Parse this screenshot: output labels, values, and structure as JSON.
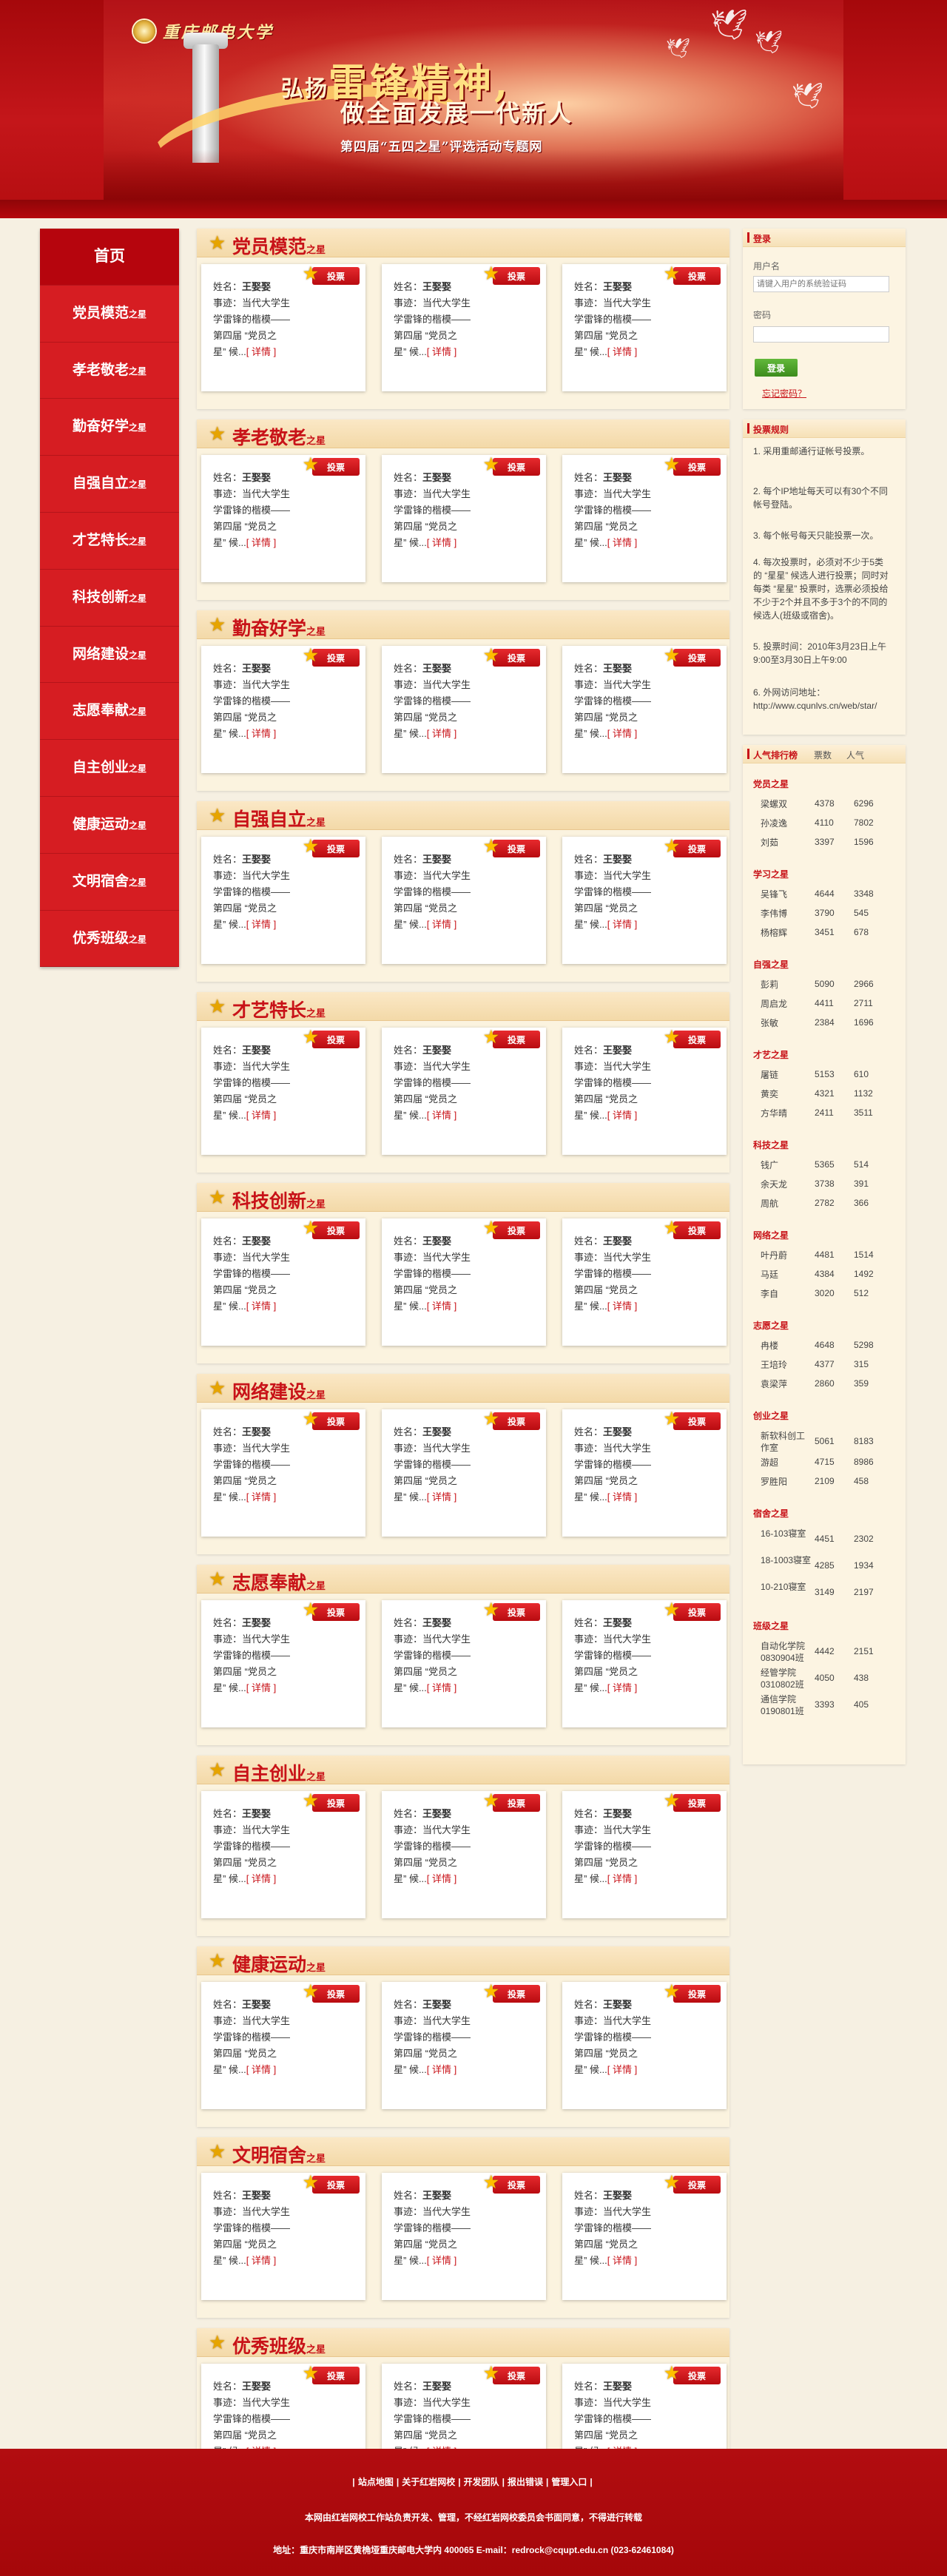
{
  "header": {
    "school_name": "重庆邮电大学",
    "slogan_small": "弘扬",
    "slogan_big": "雷锋精神,",
    "slogan_line2": "做全面发展一代新人",
    "subtitle": "第四届“五四之星”评选活动专题网"
  },
  "nav": {
    "home": "首页",
    "items": [
      {
        "main": "党员模范",
        "suffix": "之星"
      },
      {
        "main": "孝老敬老",
        "suffix": "之星"
      },
      {
        "main": "勤奋好学",
        "suffix": "之星"
      },
      {
        "main": "自强自立",
        "suffix": "之星"
      },
      {
        "main": "才艺特长",
        "suffix": "之星"
      },
      {
        "main": "科技创新",
        "suffix": "之星"
      },
      {
        "main": "网络建设",
        "suffix": "之星"
      },
      {
        "main": "志愿奉献",
        "suffix": "之星"
      },
      {
        "main": "自主创业",
        "suffix": "之星"
      },
      {
        "main": "健康运动",
        "suffix": "之星"
      },
      {
        "main": "文明宿舍",
        "suffix": "之星"
      },
      {
        "main": "优秀班级",
        "suffix": "之星"
      }
    ]
  },
  "card": {
    "vote_label": "投票",
    "name_label": "姓名：",
    "name_value": "王娶娶",
    "line2": "事迹：当代大学生",
    "line3": "学雷锋的楷模——",
    "line4": "第四届 “党员之",
    "line5_pre": "星” 候...",
    "detail_text": "[ 详情 ]"
  },
  "sections": [
    {
      "title": "党员模范",
      "suffix": "之星"
    },
    {
      "title": "孝老敬老",
      "suffix": "之星"
    },
    {
      "title": "勤奋好学",
      "suffix": "之星"
    },
    {
      "title": "自强自立",
      "suffix": "之星"
    },
    {
      "title": "才艺特长",
      "suffix": "之星"
    },
    {
      "title": "科技创新",
      "suffix": "之星"
    },
    {
      "title": "网络建设",
      "suffix": "之星"
    },
    {
      "title": "志愿奉献",
      "suffix": "之星"
    },
    {
      "title": "自主创业",
      "suffix": "之星"
    },
    {
      "title": "健康运动",
      "suffix": "之星"
    },
    {
      "title": "文明宿舍",
      "suffix": "之星"
    },
    {
      "title": "优秀班级",
      "suffix": "之星"
    }
  ],
  "login": {
    "title": "登录",
    "username_label": "用户名",
    "username_placeholder": "请键入用户的系统验证码",
    "password_label": "密码",
    "password_placeholder": "",
    "submit_label": "登录",
    "forgot_label": "忘记密码？"
  },
  "rules": {
    "title": "投票规则",
    "items": [
      "1. 采用重邮通行证帐号投票。",
      "2. 每个IP地址每天可以有30个不同帐号登陆。",
      "3. 每个帐号每天只能投票一次。",
      "4. 每次投票时，必须对不少于5类的 “星星” 候选人进行投票；同时对每类 “星星” 投票时，选票必须投给不少于2个并且不多于3个的不同的候选人(班级或宿舍)。",
      "5. 投票时间：2010年3月23日上午9:00至3月30日上午9:00",
      "6. 外网访问地址：http://www.cqunlvs.cn/web/star/"
    ]
  },
  "ranking": {
    "title": "人气排行榜",
    "col_votes": "票数",
    "col_pop": "人气",
    "groups": [
      {
        "name": "党员之星",
        "rows": [
          [
            "梁螺双",
            "4378",
            "6296"
          ],
          [
            "孙凌逸",
            "4110",
            "7802"
          ],
          [
            "刘茹",
            "3397",
            "1596"
          ]
        ]
      },
      {
        "name": "学习之星",
        "rows": [
          [
            "吴锋飞",
            "4644",
            "3348"
          ],
          [
            "李伟博",
            "3790",
            "545"
          ],
          [
            "杨榕辉",
            "3451",
            "678"
          ]
        ]
      },
      {
        "name": "自强之星",
        "rows": [
          [
            "彭莉",
            "5090",
            "2966"
          ],
          [
            "周启龙",
            "4411",
            "2711"
          ],
          [
            "张敏",
            "2384",
            "1696"
          ]
        ]
      },
      {
        "name": "才艺之星",
        "rows": [
          [
            "屠链",
            "5153",
            "610"
          ],
          [
            "黄奕",
            "4321",
            "1132"
          ],
          [
            "方华晴",
            "2411",
            "3511"
          ]
        ]
      },
      {
        "name": "科技之星",
        "rows": [
          [
            "钱广",
            "5365",
            "514"
          ],
          [
            "余天龙",
            "3738",
            "391"
          ],
          [
            "周航",
            "2782",
            "366"
          ]
        ]
      },
      {
        "name": "网络之星",
        "rows": [
          [
            "叶丹蔚",
            "4481",
            "1514"
          ],
          [
            "马廷",
            "4384",
            "1492"
          ],
          [
            "李自",
            "3020",
            "512"
          ]
        ]
      },
      {
        "name": "志愿之星",
        "rows": [
          [
            "冉楼",
            "4648",
            "5298"
          ],
          [
            "王培玲",
            "4377",
            "315"
          ],
          [
            "袁梁萍",
            "2860",
            "359"
          ]
        ]
      },
      {
        "name": "创业之星",
        "rows": [
          [
            "新软科创工作室",
            "5061",
            "8183"
          ],
          [
            "游超",
            "4715",
            "8986"
          ],
          [
            "罗胜阳",
            "2109",
            "458"
          ]
        ]
      },
      {
        "name": "宿舍之星",
        "rows": [
          [
            "16-103寝室",
            "4451",
            "2302"
          ],
          [
            "18-1003寝室",
            "4285",
            "1934"
          ],
          [
            "10-210寝室",
            "3149",
            "2197"
          ]
        ]
      },
      {
        "name": "班级之星",
        "rows": [
          [
            "自动化学院0830904班",
            "4442",
            "2151"
          ],
          [
            "经管学院0310802班",
            "4050",
            "438"
          ],
          [
            "通信学院0190801班",
            "3393",
            "405"
          ]
        ]
      }
    ]
  },
  "footer": {
    "links": [
      "站点地图",
      "关于红岩网校",
      "开发团队",
      "报出错误",
      "管理入口"
    ],
    "notice": "本网由红岩网校工作站负责开发、管理，不经红岩网校委员会书面同意，不得进行转载",
    "address": "地址：重庆市南岸区黄桷垭重庆邮电大学内 400065 E-mail：redrock@cqupt.edu.cn (023-62461084)"
  },
  "colors": {
    "brand_red": "#c81218",
    "nav_red": "#d61d22",
    "page_bg": "#f6f0e2",
    "login_green": "#4aa02a"
  },
  "icons": {
    "section_title": "star-icon",
    "vote_badge": "star-icon",
    "header_emblem": "school-emblem-icon",
    "header_birds": "dove-icon"
  }
}
